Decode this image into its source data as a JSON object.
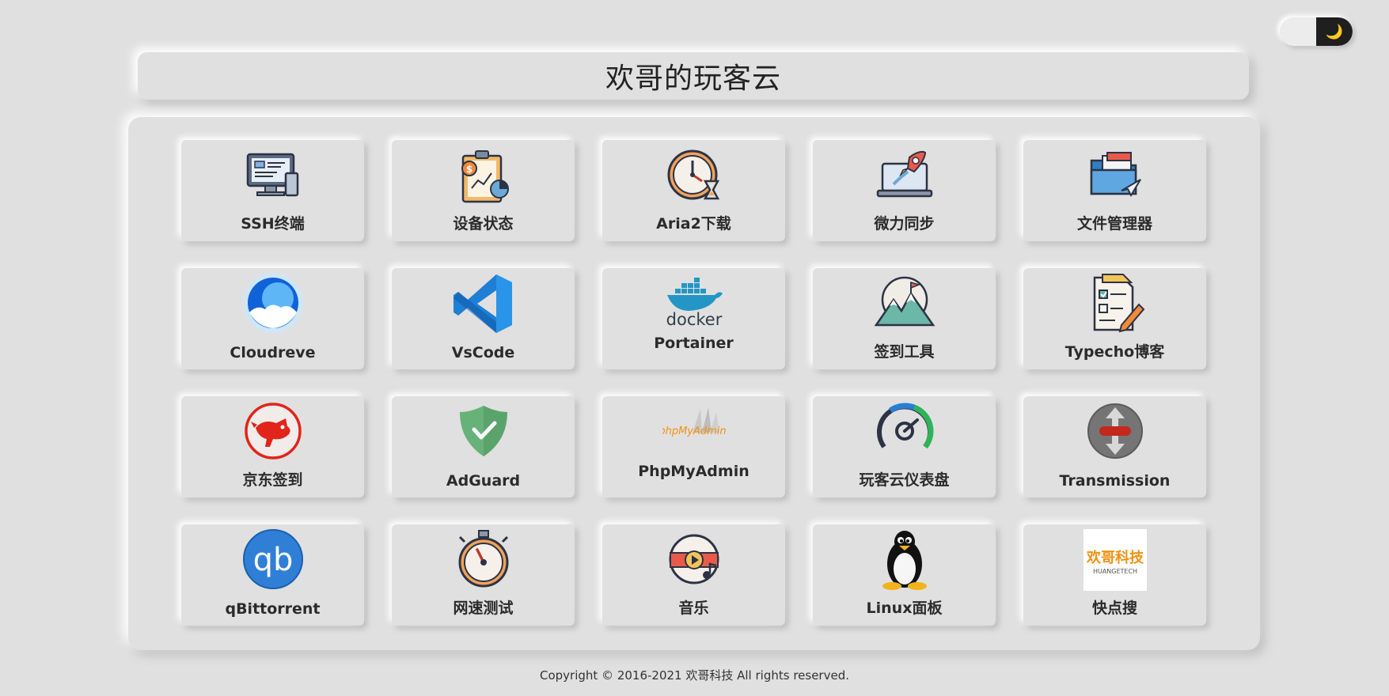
{
  "title": "欢哥的玩客云",
  "theme_toggle": {
    "icon": "moon-icon",
    "glyph": "🌙"
  },
  "apps": [
    {
      "label": "SSH终端",
      "icon": "computer-terminal-icon"
    },
    {
      "label": "设备状态",
      "icon": "clipboard-chart-icon"
    },
    {
      "label": "Aria2下载",
      "icon": "clock-hourglass-icon"
    },
    {
      "label": "微力同步",
      "icon": "laptop-rocket-icon"
    },
    {
      "label": "文件管理器",
      "icon": "folder-icon"
    },
    {
      "label": "Cloudreve",
      "icon": "cloudreve-icon"
    },
    {
      "label": "VsCode",
      "icon": "vscode-icon"
    },
    {
      "label": "Portainer",
      "icon": "docker-icon",
      "logo_text": "docker"
    },
    {
      "label": "签到工具",
      "icon": "mountain-flag-icon"
    },
    {
      "label": "Typecho博客",
      "icon": "document-pencil-icon"
    },
    {
      "label": "京东签到",
      "icon": "jd-dog-icon"
    },
    {
      "label": "AdGuard",
      "icon": "shield-check-icon"
    },
    {
      "label": "PhpMyAdmin",
      "icon": "phpmyadmin-icon",
      "logo_text": "phpMyAdmin"
    },
    {
      "label": "玩客云仪表盘",
      "icon": "gauge-icon"
    },
    {
      "label": "Transmission",
      "icon": "transmission-icon"
    },
    {
      "label": "qBittorrent",
      "icon": "qbittorrent-icon",
      "logo_text": "qb"
    },
    {
      "label": "网速测试",
      "icon": "stopwatch-icon"
    },
    {
      "label": "音乐",
      "icon": "music-play-icon"
    },
    {
      "label": "Linux面板",
      "icon": "tux-penguin-icon"
    },
    {
      "label": "快点搜",
      "icon": "huangetech-logo-icon",
      "logo_text": "欢哥科技",
      "logo_subtext": "HUANGETECH"
    }
  ],
  "footer": "Copyright © 2016-2021 欢哥科技 All rights reserved."
}
